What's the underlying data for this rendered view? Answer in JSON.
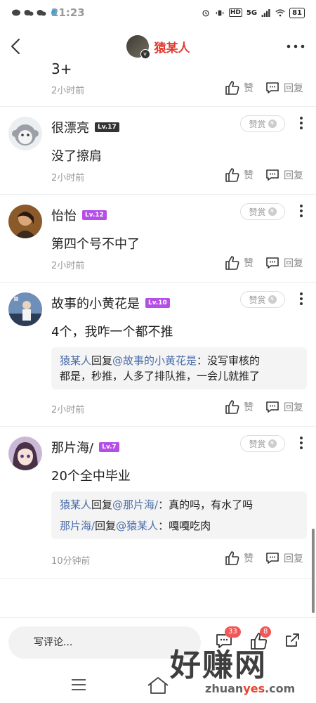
{
  "status": {
    "time": "21:23",
    "battery": "81",
    "signal_label": "5G",
    "hd_label": "HD"
  },
  "header": {
    "title": "猿某人",
    "verified_badge": "v"
  },
  "partial_comment": {
    "text_fragment": "3+",
    "time": "2小时前",
    "like_label": "赞",
    "reply_label": "回复"
  },
  "comments": [
    {
      "username": "很漂亮",
      "level": "Lv.17",
      "content": "没了擦肩",
      "time": "2小时前",
      "reward_label": "赞赏",
      "like_label": "赞",
      "reply_label": "回复"
    },
    {
      "username": "怡怡",
      "level": "Lv.12",
      "content": "第四个号不中了",
      "time": "2小时前",
      "reward_label": "赞赏",
      "like_label": "赞",
      "reply_label": "回复"
    },
    {
      "username": "故事的小黄花是",
      "level": "Lv.10",
      "content": "4个，我咋一个都不推",
      "time": "2小时前",
      "reward_label": "赞赏",
      "like_label": "赞",
      "reply_label": "回复",
      "replies": [
        {
          "from": "猿某人",
          "verb": "回复",
          "to": "@故事的小黄花是",
          "line1": "：没写审核的",
          "line2": "都是，秒推，人多了排队推，一会儿就推了"
        }
      ]
    },
    {
      "username": "那片海/",
      "level": "Lv.7",
      "content": "20个全中毕业",
      "time": "10分钟前",
      "reward_label": "赞赏",
      "like_label": "赞",
      "reply_label": "回复",
      "replies": [
        {
          "from": "猿某人",
          "verb": "回复",
          "to": "@那片海/",
          "text": "：真的吗，有水了吗"
        },
        {
          "from": "那片海/",
          "verb": "回复",
          "to": "@猿某人",
          "text": "：嘎嘎吃肉"
        }
      ]
    }
  ],
  "bottom": {
    "input_placeholder": "写评论...",
    "comment_count": "33",
    "like_count": "8"
  },
  "watermark": {
    "big": "好赚网",
    "small_prefix": "zhuan",
    "small_highlight": "yes",
    "small_suffix": ".com"
  },
  "colors": {
    "title_red": "#e03a2f",
    "reply_name_blue": "#4a6ea8",
    "badge_red": "#f25757",
    "lv_purple": "#b44ee6"
  }
}
